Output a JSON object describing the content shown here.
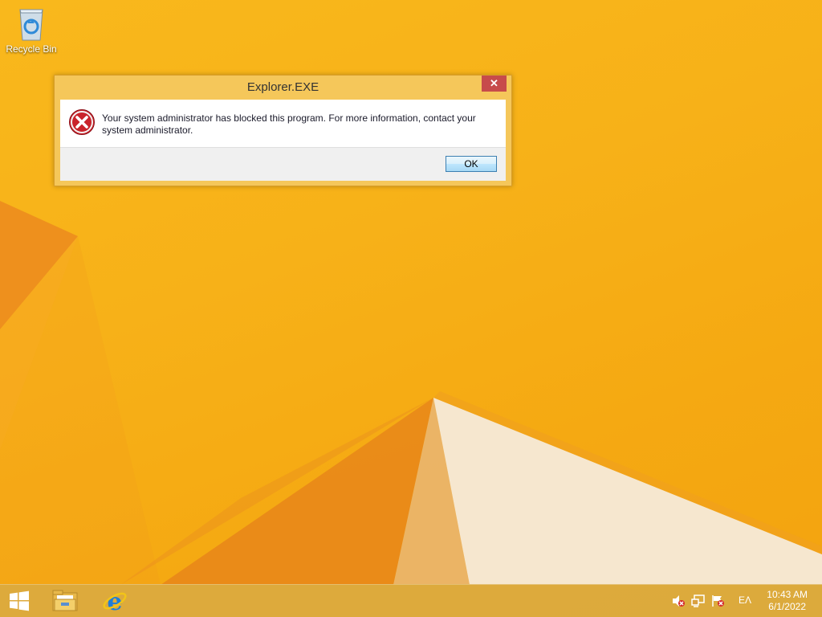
{
  "desktop": {
    "icons": [
      {
        "label": "Recycle Bin",
        "icon": "recycle-bin-icon"
      }
    ]
  },
  "dialog": {
    "title": "Explorer.EXE",
    "close_label": "✕",
    "icon": "error-icon",
    "message": "Your system administrator has blocked this program. For more information, contact your system administrator.",
    "ok_label": "OK"
  },
  "taskbar": {
    "start_icon": "windows-logo-icon",
    "pinned": [
      {
        "icon": "file-explorer-icon"
      },
      {
        "icon": "internet-explorer-icon"
      }
    ],
    "tray": {
      "icons": [
        "volume-muted-icon",
        "network-icon",
        "action-center-flag-icon"
      ],
      "language": "ΕΛ",
      "time": "10:43 AM",
      "date": "6/1/2022"
    }
  },
  "colors": {
    "wallpaper": "#f7b118",
    "dialog_frame": "#f5c75a",
    "close_button": "#c74b4b",
    "error_red": "#c9232b"
  }
}
